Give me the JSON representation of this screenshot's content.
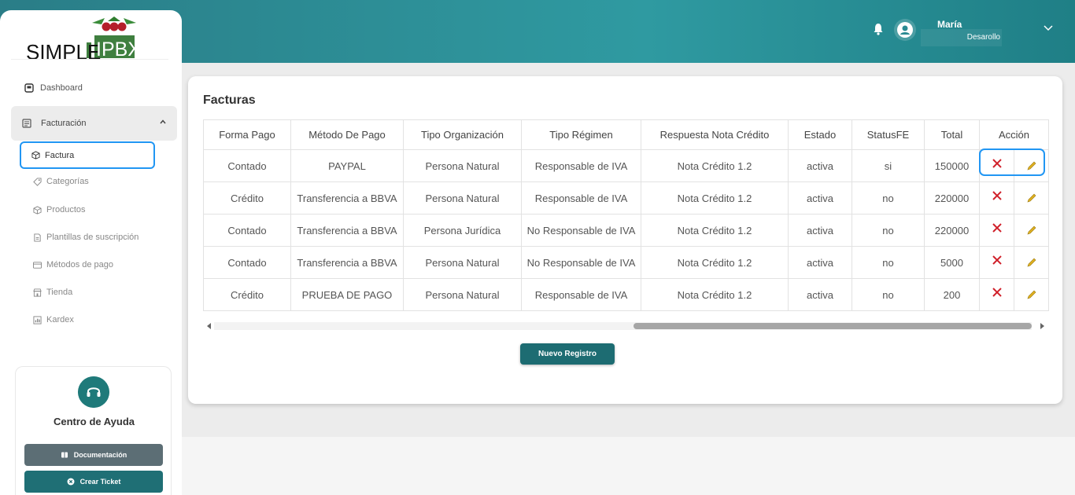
{
  "header": {
    "user_name": "María",
    "user_role": "Desarollo"
  },
  "logo": {
    "left": "SIMPLE",
    "right": "IPBX"
  },
  "sidebar": {
    "dashboard": "Dashboard",
    "group": "Facturación",
    "items": [
      {
        "label": "Factura",
        "icon": "box-icon"
      },
      {
        "label": "Categorías",
        "icon": "tag-icon"
      },
      {
        "label": "Productos",
        "icon": "box-icon"
      },
      {
        "label": "Plantillas de suscripción",
        "icon": "document-icon"
      },
      {
        "label": "Métodos de pago",
        "icon": "card-icon"
      },
      {
        "label": "Tienda",
        "icon": "store-icon"
      },
      {
        "label": "Kardex",
        "icon": "report-icon"
      }
    ]
  },
  "help": {
    "title": "Centro de Ayuda",
    "doc_label": "Documentación",
    "ticket_label": "Crear Ticket"
  },
  "main": {
    "title": "Facturas",
    "columns": [
      "Forma Pago",
      "Método De Pago",
      "Tipo Organización",
      "Tipo Régimen",
      "Respuesta Nota Crédito",
      "Estado",
      "StatusFE",
      "Total",
      "Acción"
    ],
    "rows": [
      [
        "Contado",
        "PAYPAL",
        "Persona Natural",
        "Responsable de IVA",
        "Nota Crédito 1.2",
        "activa",
        "si",
        "150000"
      ],
      [
        "Crédito",
        "Transferencia a BBVA",
        "Persona Natural",
        "Responsable de IVA",
        "Nota Crédito 1.2",
        "activa",
        "no",
        "220000"
      ],
      [
        "Contado",
        "Transferencia a BBVA",
        "Persona Jurídica",
        "No Responsable de IVA",
        "Nota Crédito 1.2",
        "activa",
        "no",
        "220000"
      ],
      [
        "Contado",
        "Transferencia a BBVA",
        "Persona Natural",
        "No Responsable de IVA",
        "Nota Crédito 1.2",
        "activa",
        "no",
        "5000"
      ],
      [
        "Crédito",
        "PRUEBA DE PAGO",
        "Persona Natural",
        "Responsable de IVA",
        "Nota Crédito 1.2",
        "activa",
        "no",
        "200"
      ]
    ],
    "new_button": "Nuevo Registro"
  },
  "colors": {
    "header_teal": "#2a8a92",
    "button_teal": "#1d6c72",
    "highlight_blue": "#2196f3",
    "delete_red": "#d0202a",
    "edit_yellow": "#e0b020"
  }
}
